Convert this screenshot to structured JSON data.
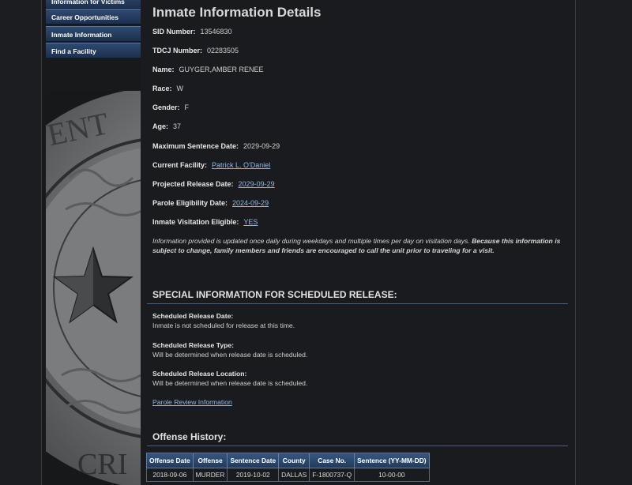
{
  "sidebar": {
    "items": [
      {
        "label": "Information for Victims"
      },
      {
        "label": "Career Opportunities"
      },
      {
        "label": "Inmate Information"
      },
      {
        "label": "Find a Facility"
      }
    ],
    "seal_text_top": "ENT",
    "seal_text_bottom": "CRI"
  },
  "details": {
    "title": "Inmate Information Details",
    "fields": [
      {
        "label": "SID Number:",
        "value": "13546830"
      },
      {
        "label": "TDCJ Number:",
        "value": "02283505"
      },
      {
        "label": "Name:",
        "value": "GUYGER,AMBER RENEE"
      },
      {
        "label": "Race:",
        "value": "W"
      },
      {
        "label": "Gender:",
        "value": "F"
      },
      {
        "label": "Age:",
        "value": "37"
      },
      {
        "label": "Maximum Sentence Date:",
        "value": "2029-09-29"
      },
      {
        "label": "Current Facility:",
        "value": "Patrick L. O'Daniel"
      },
      {
        "label": "Projected Release Date:",
        "value": "2029-09-29"
      },
      {
        "label": "Parole Eligibility Date:",
        "value": "2024-09-29"
      },
      {
        "label": "Inmate Visitation Eligible:",
        "value": "YES"
      }
    ],
    "notice_normal": "Information provided is updated once daily during weekdays and multiple times per day on visitation days.",
    "notice_bold": "Because this information is subject to change, family members and friends are encouraged to call the unit prior to traveling for a visit."
  },
  "release": {
    "title": "SPECIAL INFORMATION FOR SCHEDULED RELEASE:",
    "date_label": "Scheduled Release Date:",
    "date_value": "Inmate is not scheduled for release at this time.",
    "type_label": "Scheduled Release Type:",
    "type_value": "Will be determined when release date is scheduled.",
    "location_label": "Scheduled Release Location:",
    "location_value": "Will be determined when release date is scheduled.",
    "parole_link": "Parole Review Information"
  },
  "offense": {
    "title": "Offense History:",
    "headers": [
      "Offense Date",
      "Offense",
      "Sentence Date",
      "County",
      "Case No.",
      "Sentence (YY-MM-DD)"
    ],
    "rows": [
      [
        "2018-09-06",
        "MURDER",
        "2019-10-02",
        "DALLAS",
        "F-1800737-Q",
        "10-00-00"
      ]
    ]
  },
  "colors": {
    "background": "#1a1b1e",
    "nav_blue": "#2f4a6f",
    "link": "#8fb8e8",
    "rule": "#48617f"
  }
}
